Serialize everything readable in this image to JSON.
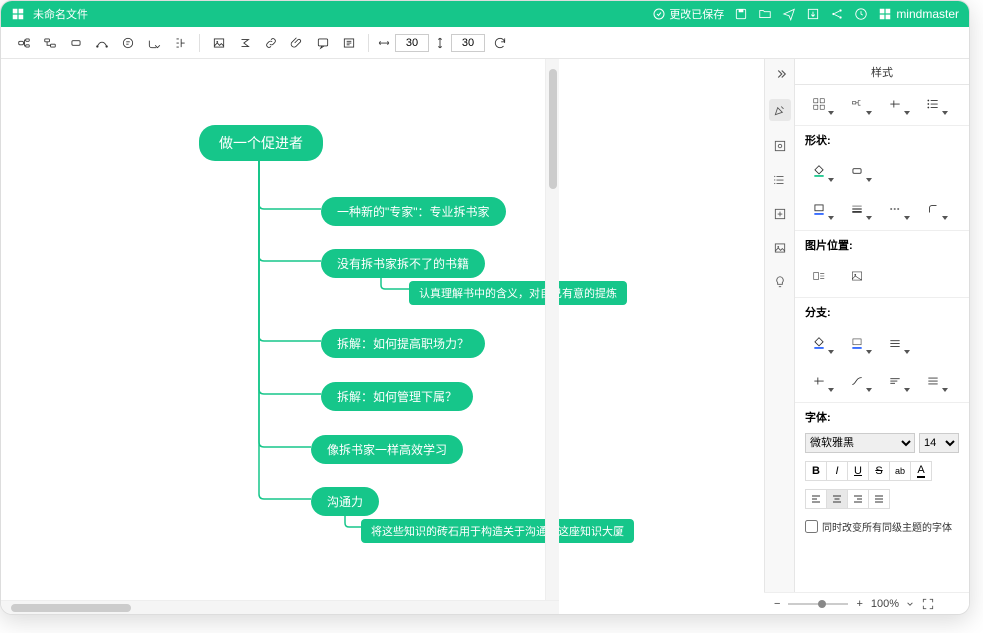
{
  "header": {
    "title": "未命名文件",
    "save_status": "更改已保存",
    "brand": "mindmaster"
  },
  "toolbar": {
    "width_value": "30",
    "height_value": "30"
  },
  "mindmap": {
    "root": "做一个促进者",
    "children": [
      {
        "text": "一种新的\"专家\"：专业拆书家"
      },
      {
        "text": "没有拆书家拆不了的书籍",
        "sub": "认真理解书中的含义，对自己有意的提炼"
      },
      {
        "text": "拆解：如何提高职场力？"
      },
      {
        "text": "拆解：如何管理下属？"
      },
      {
        "text": "像拆书家一样高效学习"
      },
      {
        "text": "沟通力",
        "sub": "将这些知识的砖石用于构造关于沟通力这座知识大厦"
      }
    ]
  },
  "panel": {
    "title": "样式",
    "shape_label": "形状:",
    "image_pos_label": "图片位置:",
    "branch_label": "分支:",
    "font_label": "字体:",
    "font_name": "微软雅黑",
    "font_size": "14",
    "sync_checkbox": "同时改变所有同级主题的字体"
  },
  "status": {
    "zoom": "100%"
  },
  "colors": {
    "accent": "#16c68a"
  }
}
